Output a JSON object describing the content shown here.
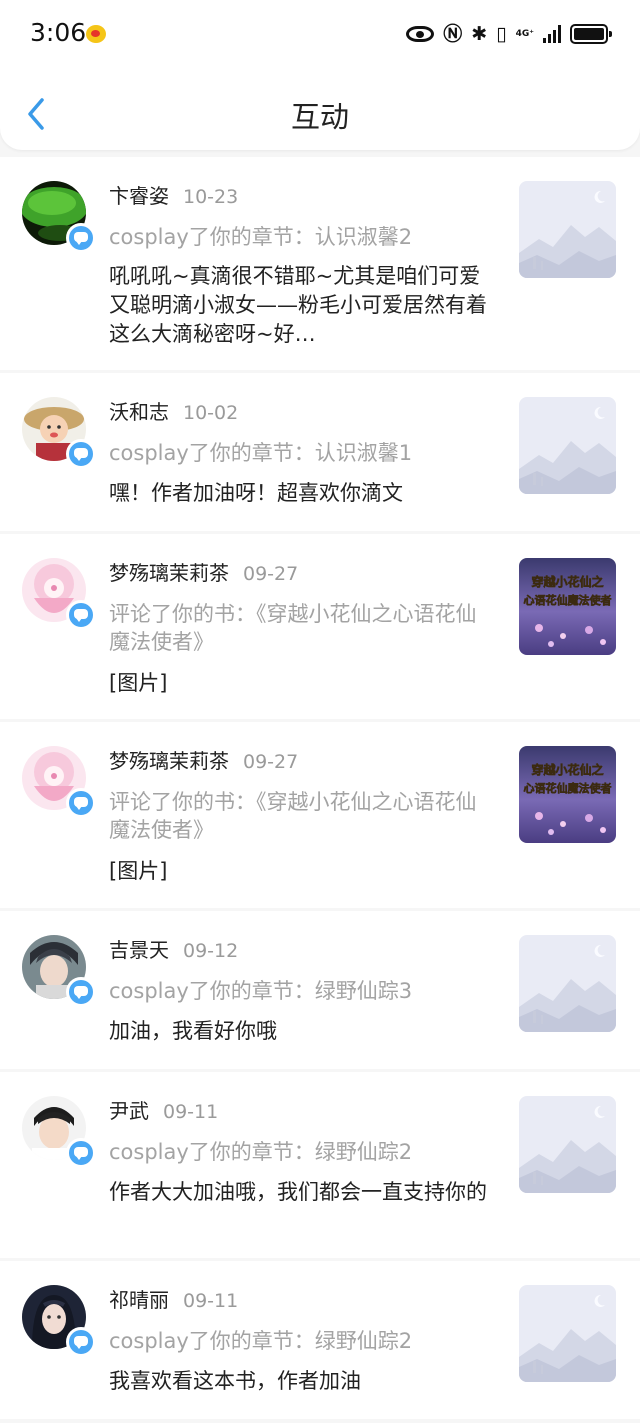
{
  "status_bar": {
    "time": "3:06",
    "network_label": "4G⁺",
    "icons": [
      "weibo-icon",
      "eye-icon",
      "nfc-icon",
      "bluetooth-icon",
      "vibrate-icon",
      "signal-icon",
      "battery-icon"
    ]
  },
  "header": {
    "title": "互动",
    "back_icon": "chevron-left-icon"
  },
  "colors": {
    "accent": "#4aa8f5",
    "text": "#222222",
    "secondary": "#a3a3a3"
  },
  "feed": [
    {
      "name": "卞睿姿",
      "date": "10-23",
      "action": "cosplay了你的章节：认识淑馨2",
      "comment": "吼吼吼~真滴很不错耶~尤其是咱们可爱又聪明滴小淑女——粉毛小可爱居然有着这么大滴秘密呀~好…",
      "thumb": "placeholder",
      "avatar": "green-leaf"
    },
    {
      "name": "沃和志",
      "date": "10-02",
      "action": "cosplay了你的章节：认识淑馨1",
      "comment": "嘿！作者加油呀！超喜欢你滴文",
      "thumb": "placeholder",
      "avatar": "girl-hat"
    },
    {
      "name": "梦殇璃茉莉茶",
      "date": "09-27",
      "action": "评论了你的书：《穿越小花仙之心语花仙魔法使者》",
      "comment": "[图片]",
      "thumb": "book-cover",
      "thumb_text": "穿越小花仙之心语花仙魔法使者",
      "avatar": "pink-anime"
    },
    {
      "name": "梦殇璃茉莉茶",
      "date": "09-27",
      "action": "评论了你的书：《穿越小花仙之心语花仙魔法使者》",
      "comment": "[图片]",
      "thumb": "book-cover",
      "thumb_text": "穿越小花仙之心语花仙魔法使者",
      "avatar": "pink-anime"
    },
    {
      "name": "吉景天",
      "date": "09-12",
      "action": "cosplay了你的章节：绿野仙踪3",
      "comment": "加油，我看好你哦",
      "thumb": "placeholder",
      "avatar": "anime-boy"
    },
    {
      "name": "尹武",
      "date": "09-11",
      "action": "cosplay了你的章节：绿野仙踪2",
      "comment": "作者大大加油哦，我们都会一直支持你的",
      "thumb": "placeholder",
      "avatar": "boy-photo"
    },
    {
      "name": "祁晴丽",
      "date": "09-11",
      "action": "cosplay了你的章节：绿野仙踪2",
      "comment": "我喜欢看这本书，作者加油",
      "thumb": "placeholder",
      "avatar": "girl-dark"
    }
  ]
}
